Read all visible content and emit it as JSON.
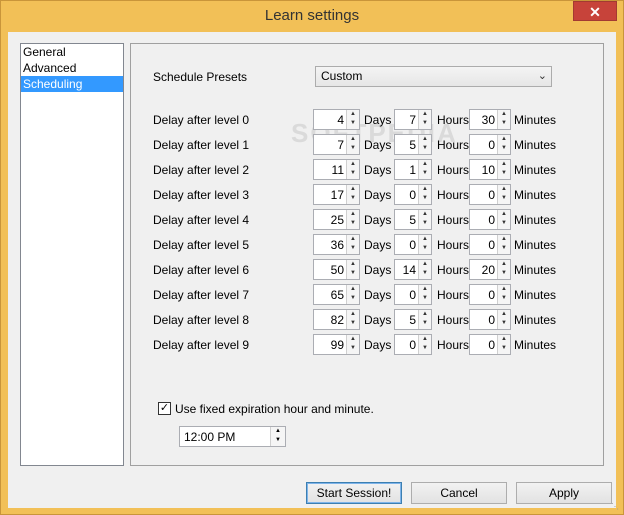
{
  "window": {
    "title": "Learn settings",
    "close_glyph": "✕"
  },
  "nav": {
    "items": [
      {
        "label": "General",
        "selected": false
      },
      {
        "label": "Advanced",
        "selected": false
      },
      {
        "label": "Scheduling",
        "selected": true
      }
    ]
  },
  "schedule": {
    "preset_label": "Schedule Presets",
    "preset_value": "Custom",
    "units": {
      "days": "Days",
      "hours": "Hours",
      "minutes": "Minutes"
    },
    "rows": [
      {
        "label": "Delay after level 0",
        "days": "4",
        "hours": "7",
        "minutes": "30"
      },
      {
        "label": "Delay after level 1",
        "days": "7",
        "hours": "5",
        "minutes": "0"
      },
      {
        "label": "Delay after level 2",
        "days": "11",
        "hours": "1",
        "minutes": "10"
      },
      {
        "label": "Delay after level 3",
        "days": "17",
        "hours": "0",
        "minutes": "0"
      },
      {
        "label": "Delay after level 4",
        "days": "25",
        "hours": "5",
        "minutes": "0"
      },
      {
        "label": "Delay after level 5",
        "days": "36",
        "hours": "0",
        "minutes": "0"
      },
      {
        "label": "Delay after level 6",
        "days": "50",
        "hours": "14",
        "minutes": "20"
      },
      {
        "label": "Delay after level 7",
        "days": "65",
        "hours": "0",
        "minutes": "0"
      },
      {
        "label": "Delay after level 8",
        "days": "82",
        "hours": "5",
        "minutes": "0"
      },
      {
        "label": "Delay after level 9",
        "days": "99",
        "hours": "0",
        "minutes": "0"
      }
    ],
    "fixed_expiration_label": "Use fixed expiration hour and minute.",
    "fixed_expiration_checked": true,
    "expiration_time": "12:00 PM"
  },
  "watermark": "SOFTPEDIA",
  "buttons": {
    "start": "Start Session!",
    "cancel": "Cancel",
    "apply": "Apply"
  },
  "colors": {
    "title_bar": "#f2c057",
    "close": "#c7433a",
    "selected": "#3399ff"
  }
}
